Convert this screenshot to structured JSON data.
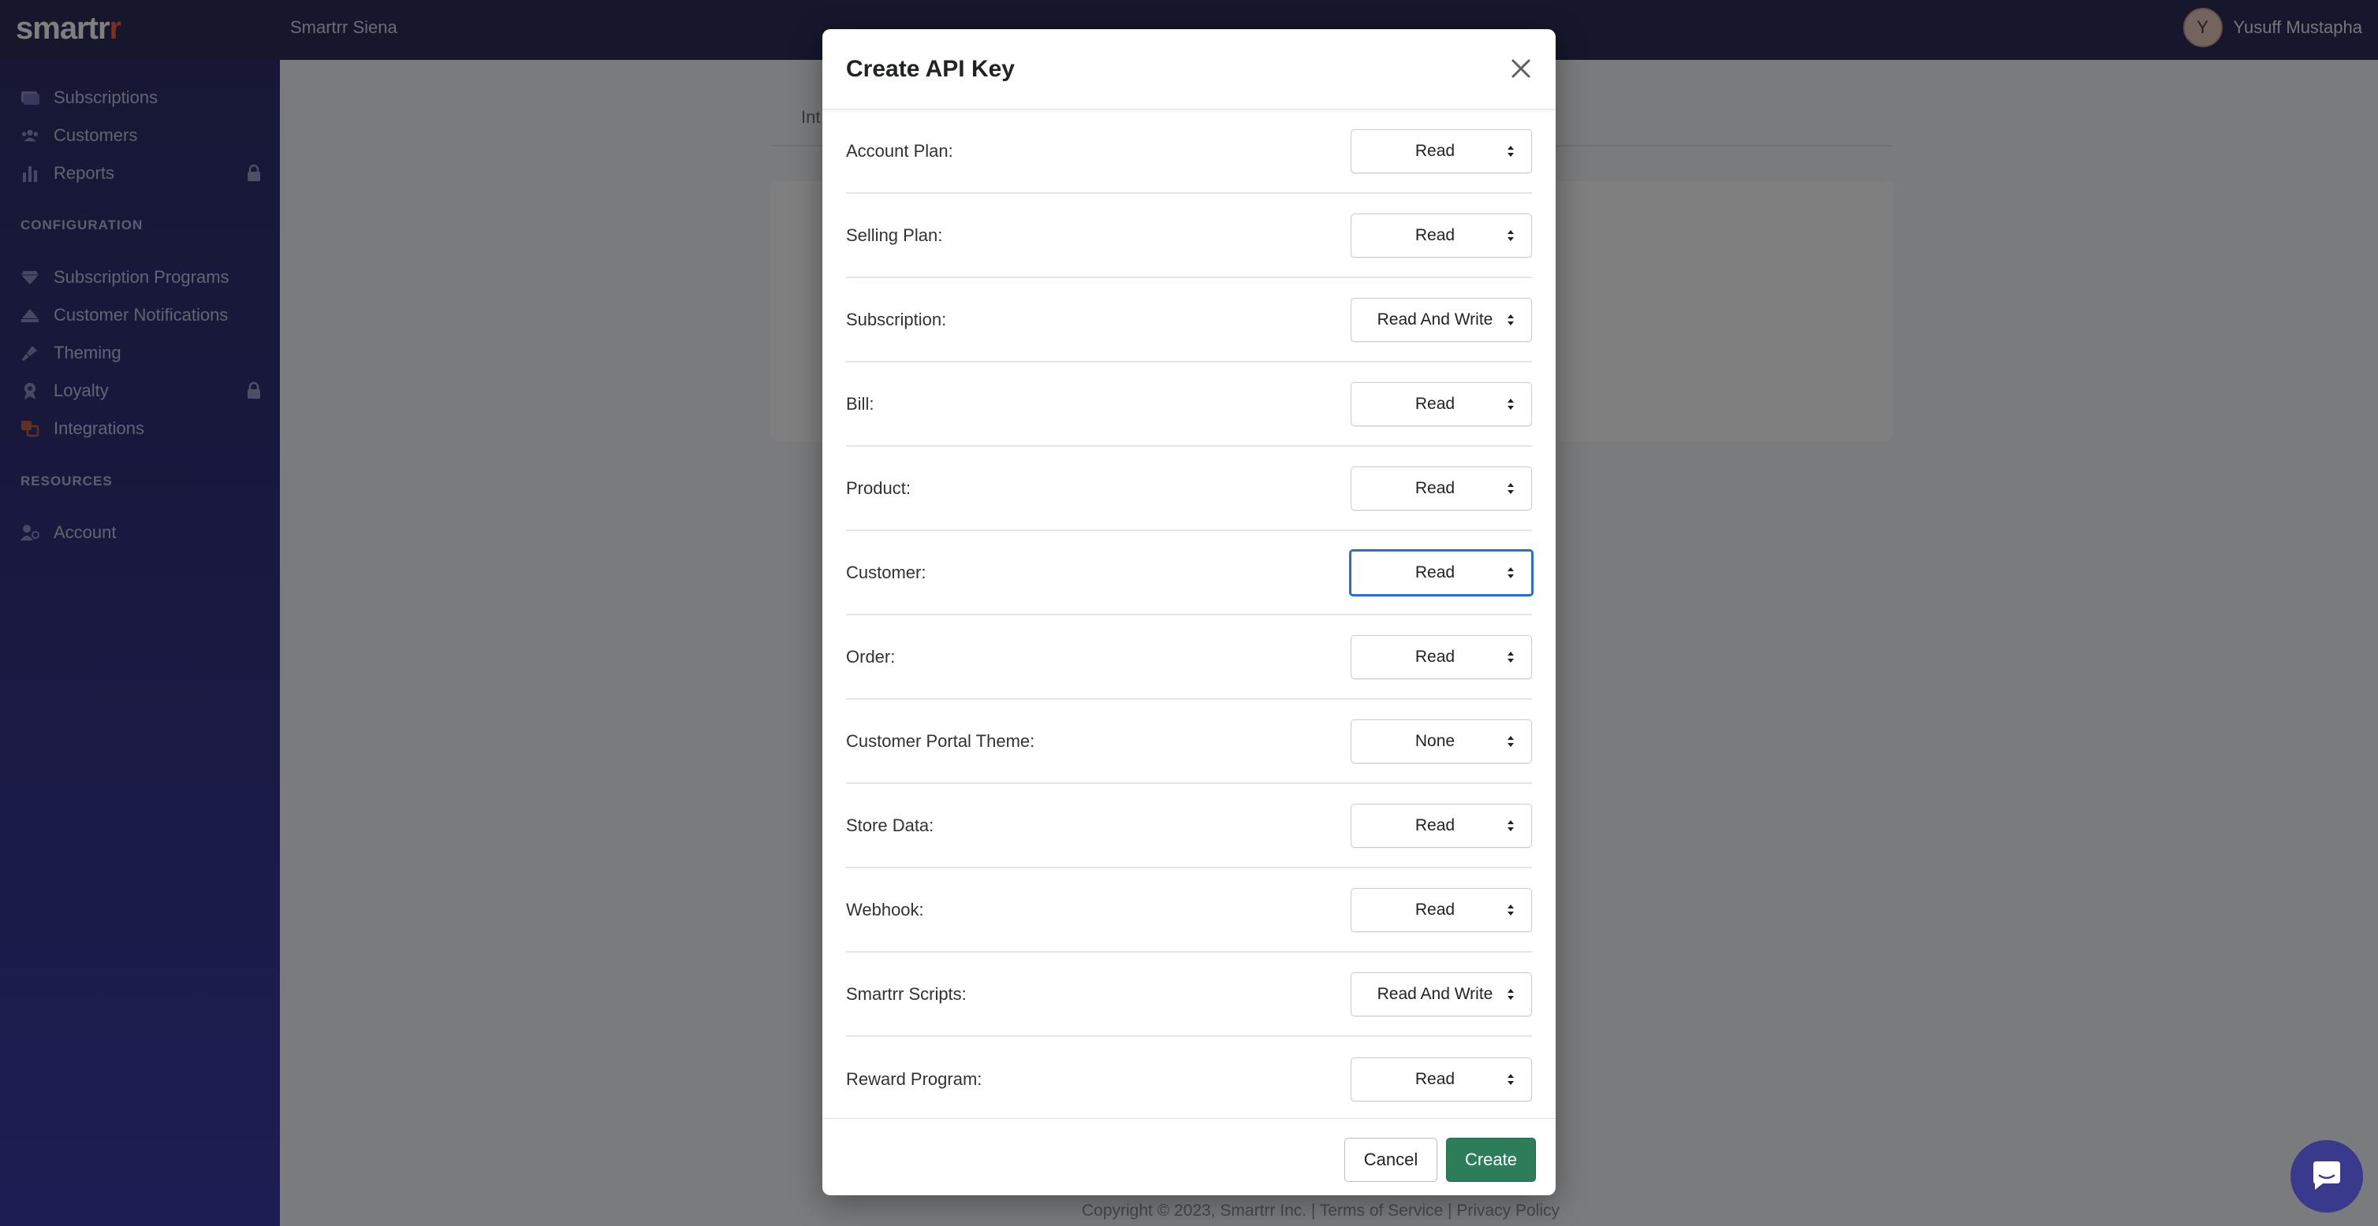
{
  "topbar": {
    "logo_main": "smartr",
    "logo_accent": "r",
    "store_name": "Smartrr Siena",
    "user_initial": "Y",
    "user_name": "Yusuff Mustapha"
  },
  "sidebar": {
    "items": [
      {
        "label": "Subscriptions",
        "icon": "subscriptions-icon"
      },
      {
        "label": "Customers",
        "icon": "customers-icon"
      },
      {
        "label": "Reports",
        "icon": "reports-icon",
        "locked": true
      }
    ],
    "config_title": "CONFIGURATION",
    "config_items": [
      {
        "label": "Subscription Programs",
        "icon": "diamond-icon"
      },
      {
        "label": "Customer Notifications",
        "icon": "notification-icon"
      },
      {
        "label": "Theming",
        "icon": "brush-icon"
      },
      {
        "label": "Loyalty",
        "icon": "loyalty-icon",
        "locked": true
      },
      {
        "label": "Integrations",
        "icon": "integrations-icon"
      }
    ],
    "resources_title": "RESOURCES",
    "resources_items": [
      {
        "label": "Account",
        "icon": "account-icon"
      }
    ]
  },
  "main": {
    "tab_partial": "Int"
  },
  "footer": {
    "text": "Copyright © 2023, Smartrr Inc. | Terms of Service | Privacy Policy"
  },
  "modal": {
    "title": "Create API Key",
    "permissions": [
      {
        "label": "Account Plan:",
        "value": "Read"
      },
      {
        "label": "Selling Plan:",
        "value": "Read"
      },
      {
        "label": "Subscription:",
        "value": "Read And Write"
      },
      {
        "label": "Bill:",
        "value": "Read"
      },
      {
        "label": "Product:",
        "value": "Read"
      },
      {
        "label": "Customer:",
        "value": "Read",
        "focused": true
      },
      {
        "label": "Order:",
        "value": "Read"
      },
      {
        "label": "Customer Portal Theme:",
        "value": "None"
      },
      {
        "label": "Store Data:",
        "value": "Read"
      },
      {
        "label": "Webhook:",
        "value": "Read"
      },
      {
        "label": "Smartrr Scripts:",
        "value": "Read And Write"
      },
      {
        "label": "Reward Program:",
        "value": "Read"
      }
    ],
    "cancel_label": "Cancel",
    "create_label": "Create"
  },
  "colors": {
    "topbar": "#2c2c5a",
    "accent_logo": "#f0623c",
    "create_button": "#2e7d5a",
    "focus_ring": "#2c6ecb"
  }
}
